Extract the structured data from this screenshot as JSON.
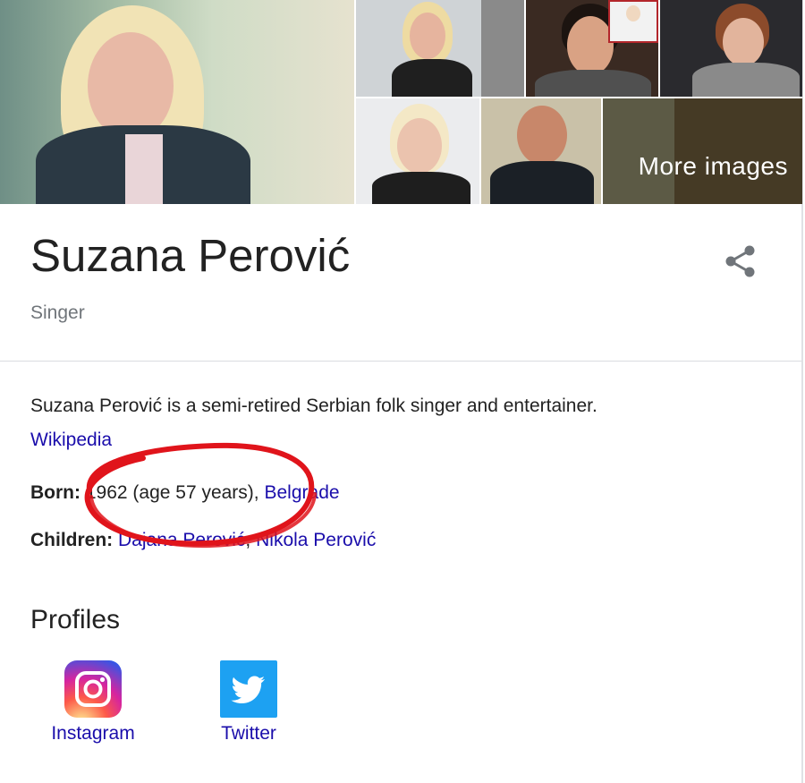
{
  "images": {
    "more_label": "More images"
  },
  "header": {
    "title": "Suzana Perović",
    "subtitle": "Singer"
  },
  "description": {
    "text": "Suzana Perović is a semi-retired Serbian folk singer and entertainer.",
    "source_link": "Wikipedia"
  },
  "facts": {
    "born_label": "Born:",
    "born_value": "1962 (age 57 years),",
    "born_place_link": "Belgrade",
    "children_label": "Children:",
    "children_link_1": "Dajana Perović",
    "children_sep": ",",
    "children_link_2": "Nikola Perović"
  },
  "profiles": {
    "heading": "Profiles",
    "items": [
      {
        "label": "Instagram",
        "icon": "instagram-icon"
      },
      {
        "label": "Twitter",
        "icon": "twitter-icon"
      }
    ]
  },
  "colors": {
    "link": "#1a0dab",
    "annotation": "#e0141b",
    "twitter": "#1da1f2"
  }
}
